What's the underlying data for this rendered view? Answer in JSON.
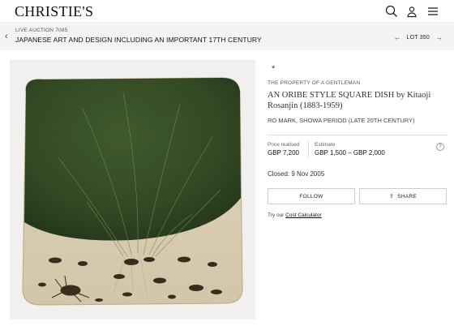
{
  "header": {
    "logo": "CHRISTIE'S",
    "icons": [
      "search-icon",
      "user-icon",
      "menu-icon"
    ]
  },
  "breadcrumb": {
    "auction_number": "LIVE AUCTION 7085",
    "auction_title": "JAPANESE ART AND DESIGN INCLUDING AN IMPORTANT 17TH CENTURY",
    "lot_label": "LOT 350"
  },
  "lot": {
    "star": "*",
    "provenance": "THE PROPERTY OF A GENTLEMAN",
    "title": "AN ORIBE STYLE SQUARE DISH by Kitaoji Rosanjin (1883-1959)",
    "subtitle": "RO MARK, SHOWA PERIOD (LATE 20TH CENTURY)",
    "price_label": "Price realised",
    "price_value": "GBP 7,200",
    "estimate_label": "Estimate",
    "estimate_value": "GBP 1,500 – GBP 2,000",
    "help": "?",
    "closed": "Closed: 9 Nov 2005"
  },
  "actions": {
    "follow": "FOLLOW",
    "share": "SHARE",
    "cost_prefix": "Try our",
    "cost_link": "Cost Calculator"
  },
  "colors": {
    "glaze_green": "#3d5a2a",
    "clay_cream": "#ddd1b8",
    "background_panel": "#f1f0ee"
  }
}
